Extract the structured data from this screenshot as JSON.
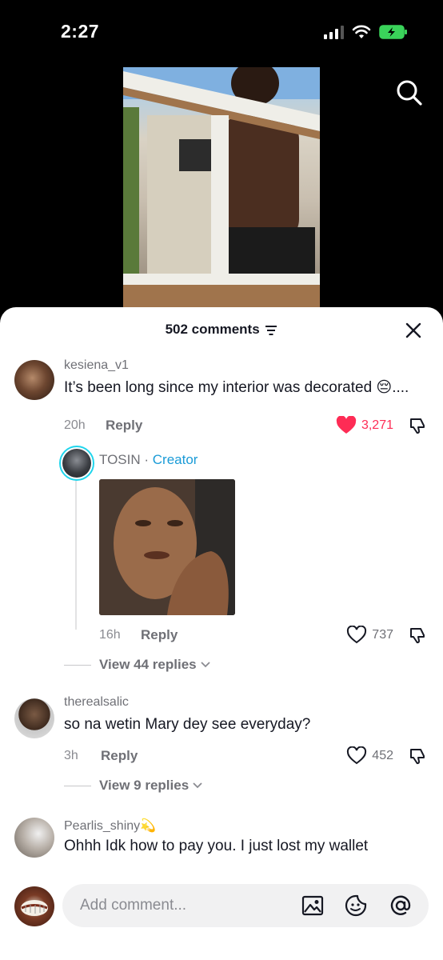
{
  "status": {
    "time": "2:27"
  },
  "header": {
    "comments_count": "502 comments"
  },
  "comments": [
    {
      "username": "kesiena_v1",
      "text": "It’s been long since my interior was decorated 😔....",
      "time": "20h",
      "reply_label": "Reply",
      "likes": "3,271",
      "liked": true
    },
    {
      "username": "therealsalic",
      "text": "so na wetin Mary dey see everyday?",
      "time": "3h",
      "reply_label": "Reply",
      "likes": "452",
      "liked": false
    },
    {
      "username": "Pearlis_shiny💫",
      "text": "Ohhh Idk how to pay you. I just lost my wallet",
      "time": "",
      "reply_label": "",
      "likes": ""
    }
  ],
  "creator_reply": {
    "username": "TOSIN",
    "separator": " · ",
    "tag": "Creator",
    "time": "16h",
    "reply_label": "Reply",
    "likes": "737"
  },
  "view_replies": [
    {
      "label": "View 44 replies"
    },
    {
      "label": "View 9 replies"
    }
  ],
  "input": {
    "placeholder": "Add comment..."
  },
  "colors": {
    "like_active": "#fe2c55",
    "creator_tag": "#1a9bd7",
    "creator_ring": "#20d5ec"
  }
}
